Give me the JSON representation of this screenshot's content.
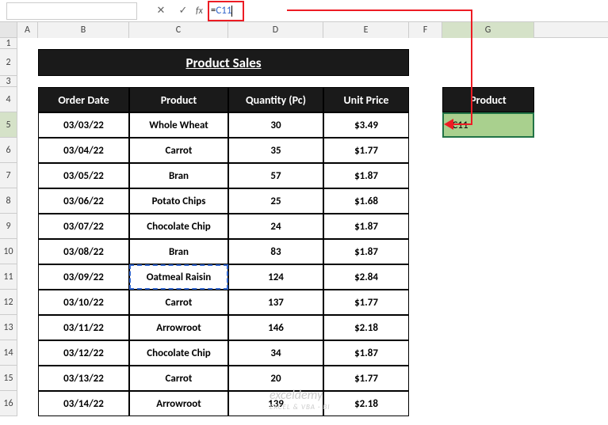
{
  "formula_bar": {
    "cancel": "✕",
    "enter": "✓",
    "fx": "fx",
    "formula_eq": "=",
    "formula_ref": "C11"
  },
  "columns": [
    "A",
    "B",
    "C",
    "D",
    "E",
    "F",
    "G"
  ],
  "rows": [
    "1",
    "2",
    "3",
    "4",
    "5",
    "6",
    "7",
    "8",
    "9",
    "10",
    "11",
    "12",
    "13",
    "14",
    "15",
    "16"
  ],
  "active_row": "5",
  "active_col": "G",
  "title": "Product Sales",
  "headers": {
    "order_date": "Order Date",
    "product": "Product",
    "quantity": "Quantity (Pc)",
    "unit_price": "Unit Price"
  },
  "data_rows": [
    {
      "date": "03/03/22",
      "product": "Whole Wheat",
      "qty": "30",
      "price": "$3.49"
    },
    {
      "date": "03/04/22",
      "product": "Carrot",
      "qty": "35",
      "price": "$1.77"
    },
    {
      "date": "03/05/22",
      "product": "Bran",
      "qty": "57",
      "price": "$1.87"
    },
    {
      "date": "03/06/22",
      "product": "Potato Chips",
      "qty": "25",
      "price": "$1.68"
    },
    {
      "date": "03/07/22",
      "product": "Chocolate Chip",
      "qty": "24",
      "price": "$1.87"
    },
    {
      "date": "03/08/22",
      "product": "Bran",
      "qty": "83",
      "price": "$1.87"
    },
    {
      "date": "03/09/22",
      "product": "Oatmeal Raisin",
      "qty": "124",
      "price": "$2.84"
    },
    {
      "date": "03/10/22",
      "product": "Carrot",
      "qty": "137",
      "price": "$1.77"
    },
    {
      "date": "03/11/22",
      "product": "Arrowroot",
      "qty": "146",
      "price": "$2.18"
    },
    {
      "date": "03/12/22",
      "product": "Chocolate Chip",
      "qty": "34",
      "price": "$1.87"
    },
    {
      "date": "03/13/22",
      "product": "Carrot",
      "qty": "20",
      "price": "$1.77"
    },
    {
      "date": "03/14/22",
      "product": "Arrowroot",
      "qty": "139",
      "price": "$2.18"
    }
  ],
  "side": {
    "header": "Product",
    "editing": "=C11"
  },
  "watermark": {
    "main": "exceldemy",
    "sub": "EXCEL & VBA · BI"
  }
}
